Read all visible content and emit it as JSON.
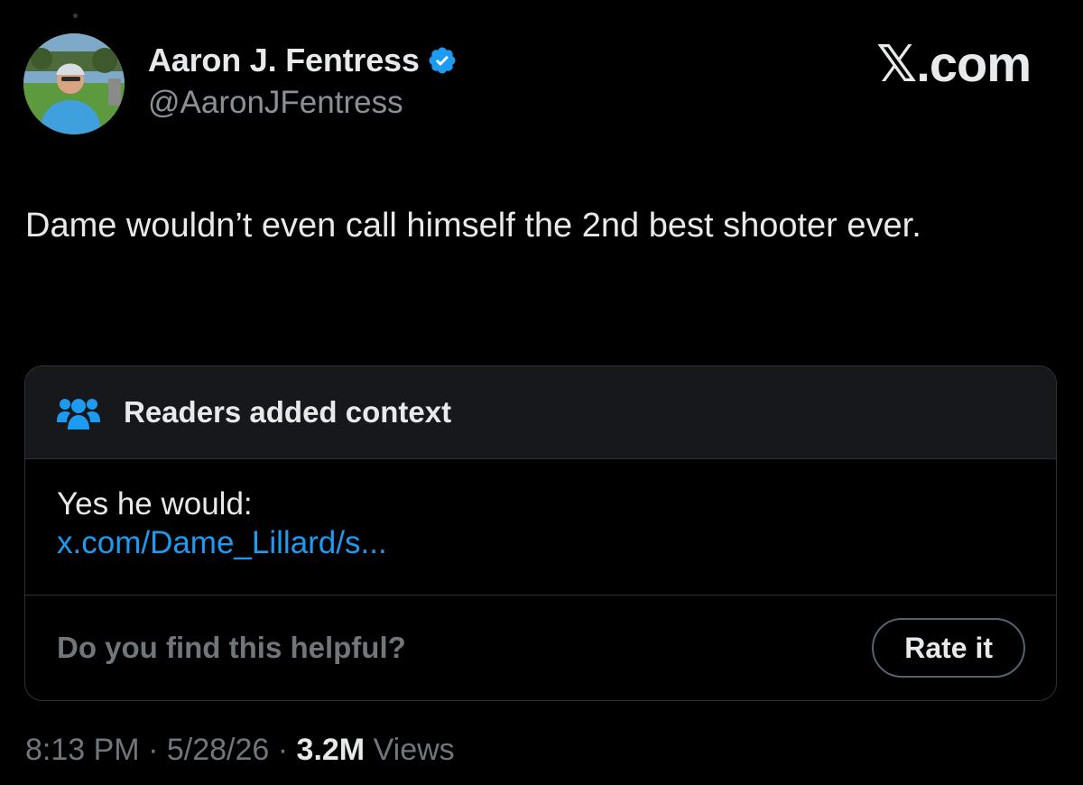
{
  "tweet": {
    "author": {
      "display_name": "Aaron J. Fentress",
      "handle": "@AaronJFentress",
      "verified": true,
      "verified_icon": "verified-badge-icon",
      "verified_color": "#1d9bf0"
    },
    "brand": "𝕏.com",
    "text": "Dame wouldn’t even call himself the 2nd best shooter ever.",
    "community_note": {
      "icon": "people-icon",
      "title": "Readers added context",
      "body": "Yes he would:",
      "link": "x.com/Dame_Lillard/s...",
      "helpful_question": "Do you find this helpful?",
      "rate_button": "Rate it"
    },
    "meta": {
      "time": "8:13 PM",
      "date": "5/28/26",
      "separator": "·",
      "views_count": "3.2M",
      "views_label": "Views"
    }
  },
  "colors": {
    "background": "#000000",
    "text_primary": "#e7e9ea",
    "text_secondary": "#71767b",
    "link": "#1d9bf0",
    "card_border": "#2f3336",
    "card_header_bg": "#16181c"
  }
}
